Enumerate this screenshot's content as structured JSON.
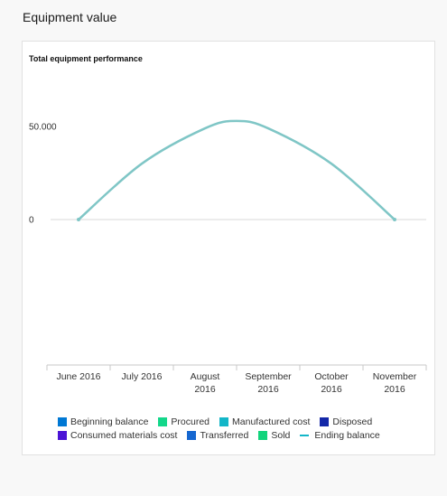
{
  "page": {
    "title": "Equipment value"
  },
  "chart_data": {
    "type": "line",
    "title": "Total equipment performance",
    "categories": [
      "June 2016",
      "July 2016",
      "August 2016",
      "September 2016",
      "October 2016",
      "November 2016"
    ],
    "category_lines": [
      [
        "June 2016"
      ],
      [
        "July 2016"
      ],
      [
        "August",
        "2016"
      ],
      [
        "September",
        "2016"
      ],
      [
        "October",
        "2016"
      ],
      [
        "November",
        "2016"
      ]
    ],
    "y_ticks": [
      {
        "value": 50000,
        "label": "50.000"
      },
      {
        "value": 0,
        "label": "0"
      }
    ],
    "ylim": [
      -90000,
      80000
    ],
    "series": [
      {
        "name": "Ending balance",
        "color": "#7fc6c6",
        "x": [
          0,
          1,
          2,
          2.5,
          3,
          4,
          5
        ],
        "values": [
          0,
          30000,
          49000,
          53000,
          49000,
          30000,
          0
        ]
      }
    ],
    "legend": {
      "placement": "bottom",
      "items": [
        {
          "label": "Beginning balance",
          "color": "#0078d4",
          "kind": "box"
        },
        {
          "label": "Procured",
          "color": "#13d78a",
          "kind": "box"
        },
        {
          "label": "Manufactured cost",
          "color": "#13b6c8",
          "kind": "box"
        },
        {
          "label": "Disposed",
          "color": "#1428a8",
          "kind": "box"
        },
        {
          "label": "Consumed materials cost",
          "color": "#4b14d6",
          "kind": "box"
        },
        {
          "label": "Transferred",
          "color": "#1667d0",
          "kind": "box"
        },
        {
          "label": "Sold",
          "color": "#12d47c",
          "kind": "box"
        },
        {
          "label": "Ending balance",
          "color": "#13b6c8",
          "kind": "line"
        }
      ]
    }
  }
}
